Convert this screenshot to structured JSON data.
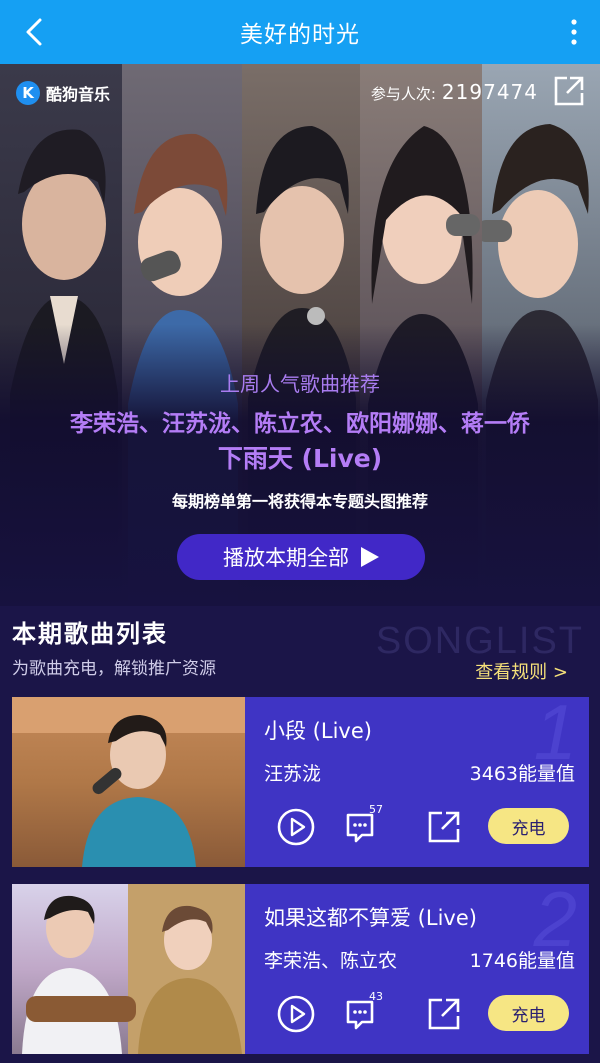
{
  "header": {
    "title": "美好的时光"
  },
  "hero": {
    "logo_text": "酷狗音乐",
    "logo_letter": "K",
    "participants_label": "参与人次:",
    "participants_count": "2197474",
    "subtitle": "上周人气歌曲推荐",
    "artists": "李荣浩、汪苏泷、陈立农、欧阳娜娜、蒋一侨",
    "song": "下雨天 (Live)",
    "note": "每期榜单第一将获得本专题头图推荐",
    "play_all_label": "播放本期全部"
  },
  "songlist": {
    "title": "本期歌曲列表",
    "watermark": "SONGLIST",
    "subtitle": "为歌曲充电，解锁推广资源",
    "rules_link": "查看规则 >",
    "items": [
      {
        "rank": "1",
        "song": "小段 (Live)",
        "artist": "汪苏泷",
        "energy": "3463能量值",
        "comments": "57",
        "charge_label": "充电"
      },
      {
        "rank": "2",
        "song": "如果这都不算爱 (Live)",
        "artist": "李荣浩、陈立农",
        "energy": "1746能量值",
        "comments": "43",
        "charge_label": "充电"
      }
    ]
  },
  "colors": {
    "topbar": "#15a0f3",
    "background": "#1b1548",
    "card": "#3f34c4",
    "accent_purple": "#b47df6",
    "charge_button": "#f6e684",
    "rules_link": "#f6e17a"
  }
}
